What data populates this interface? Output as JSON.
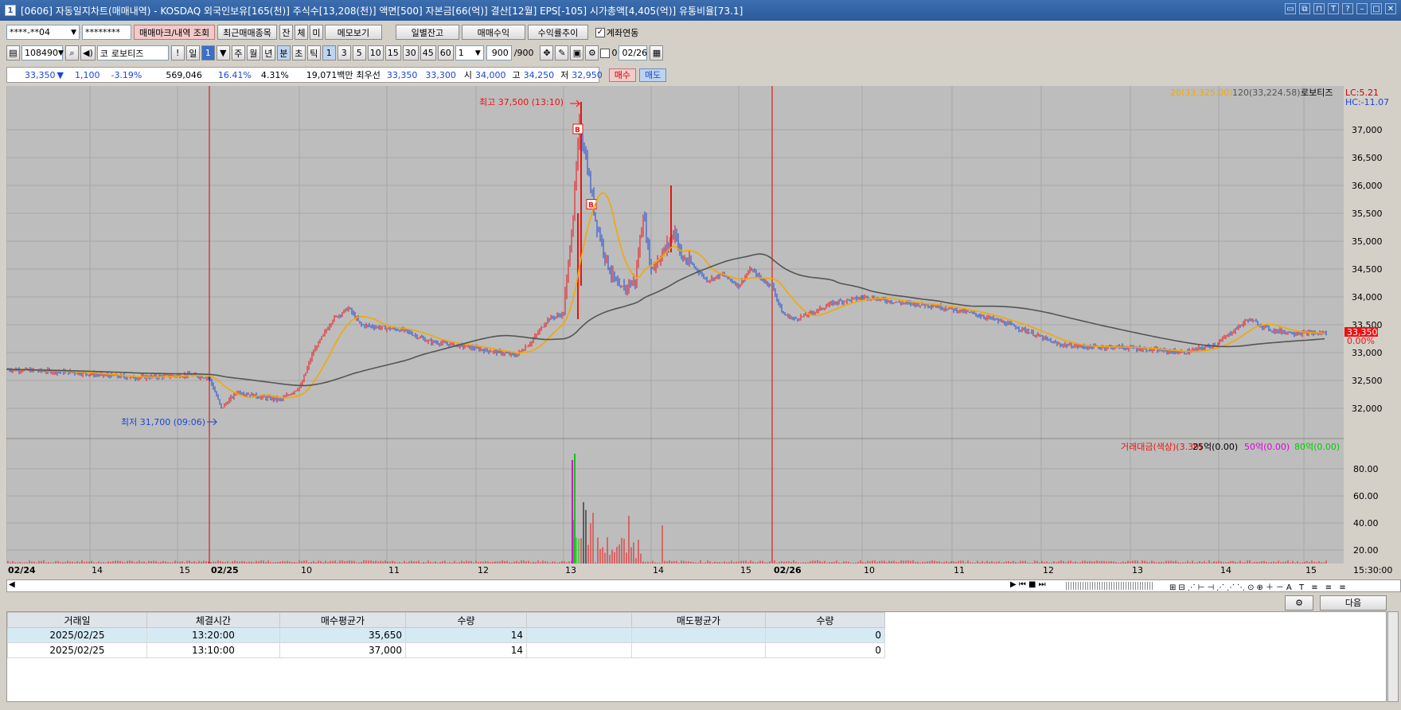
{
  "window": {
    "number": "1",
    "title": "[0606] 자동일지차트(매매내역) - KOSDAQ 외국인보유[165(천)] 주식수[13,208(천)] 액면[500] 자본금[66(억)] 결산[12월] EPS[-105] 시가총액[4,405(억)] 유통비율[73.1]"
  },
  "toolbar1": {
    "account": "****-**04",
    "password": "********",
    "mark_button": "매매마크/내역 조회",
    "recent_button": "최근매매종목",
    "btn_jan": "잔",
    "btn_che": "체",
    "btn_mi": "미",
    "memo_button": "메모보기",
    "daily_button": "일별잔고",
    "profit_button": "매매수익",
    "rate_button": "수익률추이",
    "link_checkbox": "계좌연동"
  },
  "toolbar2": {
    "code": "108490",
    "market": "코",
    "name": "로보티즈",
    "exclaim": "!",
    "period_day": "일",
    "period_value": "1",
    "periods": [
      "주",
      "월",
      "년",
      "분",
      "초",
      "틱"
    ],
    "minute_options": [
      "1",
      "3",
      "5",
      "10",
      "15",
      "30",
      "45",
      "60"
    ],
    "count_value": "1",
    "bars": "900",
    "bars_total": "/900",
    "check_label": "0",
    "date": "02/26"
  },
  "quote": {
    "price": "33,350",
    "arrow": "▼",
    "change": "1,100",
    "change_rate": "-3.19%",
    "volume": "569,046",
    "turnover": "16.41%",
    "rate2": "4.31%",
    "amount": "19,071백만",
    "best_label": "최우선",
    "best_ask": "33,350",
    "best_bid": "33,300",
    "open_label": "시",
    "open": "34,000",
    "high_label": "고",
    "high": "34,250",
    "low_label": "저",
    "low": "32,950",
    "buy_button": "매수",
    "sell_button": "매도"
  },
  "chart": {
    "legend_ma20": "20(33,325.00)",
    "legend_ma120": "120(33,224.58)",
    "legend_name": "로보티즈",
    "lc": "LC:5.21",
    "hc": "HC:-11.07",
    "high_marker": "최고 37,500 (13:10)",
    "low_marker": "최저 31,700 (09:06)",
    "current_price_tag": "33,350",
    "current_pct": "0.00%",
    "price_ticks": [
      "37,000",
      "36,500",
      "36,000",
      "35,500",
      "35,000",
      "34,500",
      "34,000",
      "33,500",
      "33,000",
      "32,500",
      "32,000"
    ],
    "vol_legend": "거래대금(색상)(3.39)",
    "vol_legend2": "25억(0.00)",
    "vol_legend3": "50억(0.00)",
    "vol_legend4": "80억(0.00)",
    "vol_ticks": [
      "80.00",
      "60.00",
      "40.00",
      "20.00"
    ],
    "time_labels": [
      "02/24",
      "14",
      "15",
      "02/25",
      "10",
      "11",
      "12",
      "13",
      "14",
      "15",
      "02/26",
      "10",
      "11",
      "12",
      "13",
      "14",
      "15"
    ],
    "close_time": "15:30:00",
    "buy_marker": "B",
    "colors": {
      "ma20": "#f2a900",
      "ma120": "#555555",
      "up": "#e11",
      "down": "#1b46d6",
      "bg": "#bdbdbd"
    }
  },
  "bottom": {
    "next_button": "다음"
  },
  "trades": {
    "headers": [
      "거래일",
      "체결시간",
      "매수평균가",
      "수량",
      "",
      "매도평균가",
      "수량"
    ],
    "rows": [
      [
        "2025/02/25",
        "13:20:00",
        "35,650",
        "14",
        "",
        "",
        "0"
      ],
      [
        "2025/02/25",
        "13:10:00",
        "37,000",
        "14",
        "",
        "",
        "0"
      ]
    ]
  }
}
